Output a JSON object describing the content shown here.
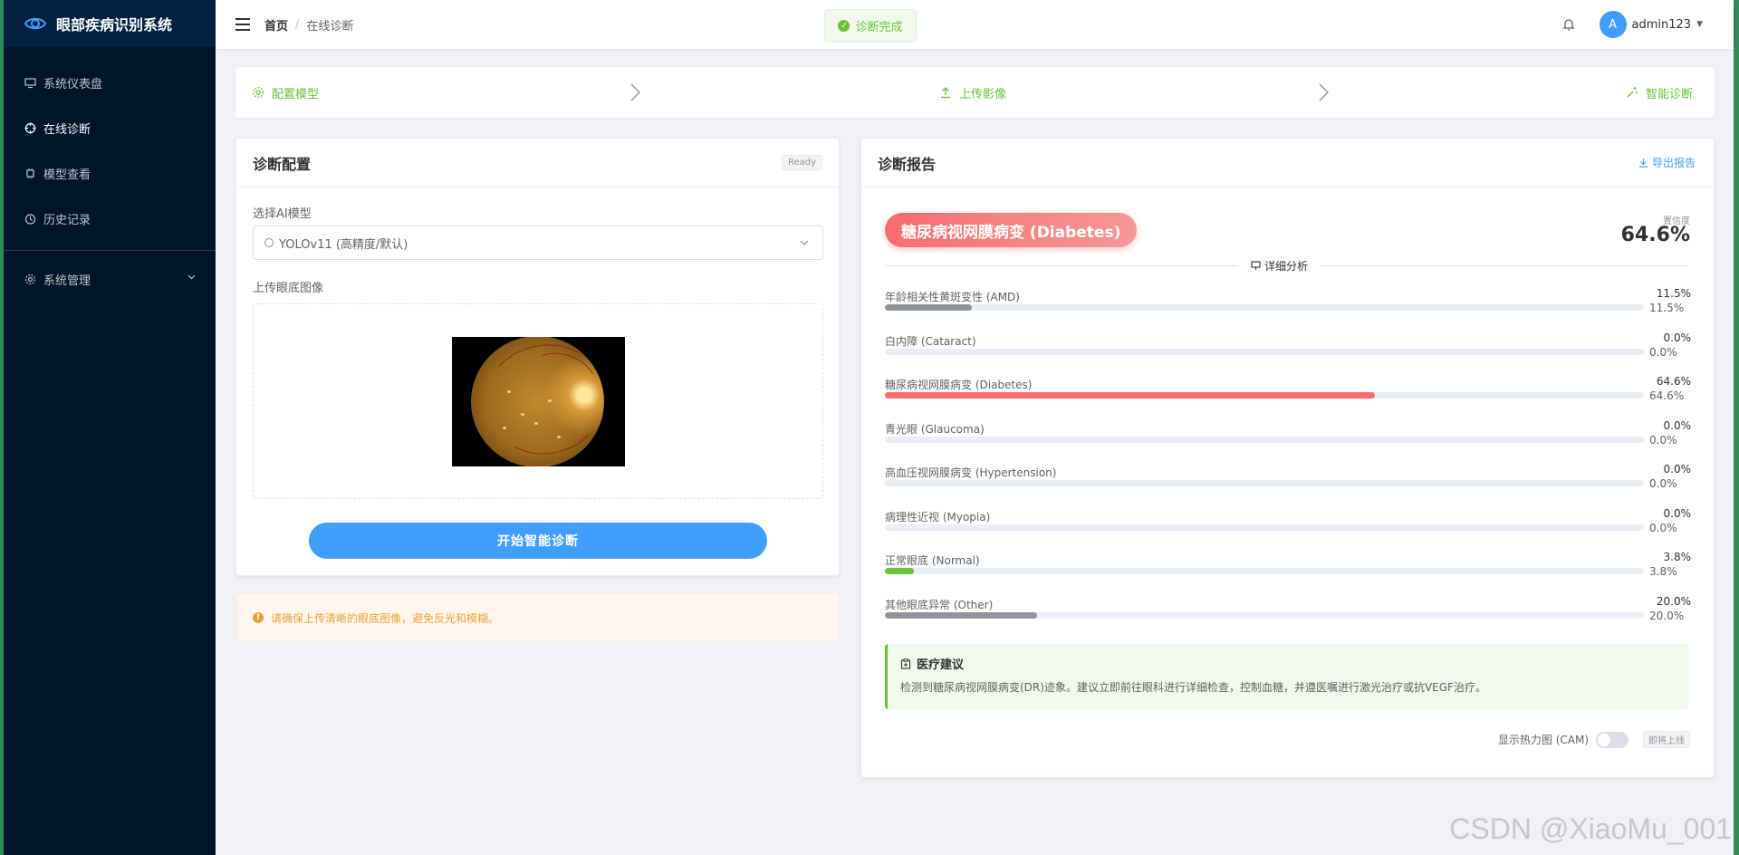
{
  "app": {
    "title": "眼部疾病识别系统"
  },
  "sidebar": {
    "items": [
      {
        "label": "系统仪表盘",
        "icon": "monitor-icon"
      },
      {
        "label": "在线诊断",
        "icon": "target-icon"
      },
      {
        "label": "模型查看",
        "icon": "chip-icon"
      },
      {
        "label": "历史记录",
        "icon": "clock-icon"
      },
      {
        "label": "系统管理",
        "icon": "gear-icon"
      }
    ]
  },
  "header": {
    "breadcrumb": [
      "首页",
      "在线诊断"
    ],
    "breadcrumb_sep": "/",
    "toast": "诊断完成",
    "avatar_letter": "A",
    "username": "admin123"
  },
  "steps": [
    {
      "label": "配置模型"
    },
    {
      "label": "上传影像"
    },
    {
      "label": "智能诊断"
    }
  ],
  "config": {
    "title": "诊断配置",
    "status": "Ready",
    "model_label": "选择AI模型",
    "model_value": "YOLOv11 (高精度/默认)",
    "upload_label": "上传眼底图像",
    "diagnose_button": "开始智能诊断"
  },
  "alert": {
    "text": "请确保上传清晰的眼底图像，避免反光和模糊。"
  },
  "report": {
    "title": "诊断报告",
    "export": "导出报告",
    "result": "糖尿病视网膜病变 (Diabetes)",
    "confidence_label": "置信度",
    "confidence": "64.6%",
    "analysis_label": "详细分析",
    "probabilities": [
      {
        "name": "年龄相关性黄斑变性 (AMD)",
        "pct": "11.5%",
        "value": 11.5,
        "color": "#909399"
      },
      {
        "name": "白内障 (Cataract)",
        "pct": "0.0%",
        "value": 0.0,
        "color": "#909399"
      },
      {
        "name": "糖尿病视网膜病变 (Diabetes)",
        "pct": "64.6%",
        "value": 64.6,
        "color": "#f56c6c"
      },
      {
        "name": "青光眼 (Glaucoma)",
        "pct": "0.0%",
        "value": 0.0,
        "color": "#909399"
      },
      {
        "name": "高血压视网膜病变 (Hypertension)",
        "pct": "0.0%",
        "value": 0.0,
        "color": "#909399"
      },
      {
        "name": "病理性近视 (Myopia)",
        "pct": "0.0%",
        "value": 0.0,
        "color": "#909399"
      },
      {
        "name": "正常眼底 (Normal)",
        "pct": "3.8%",
        "value": 3.8,
        "color": "#67c23a"
      },
      {
        "name": "其他眼底异常 (Other)",
        "pct": "20.0%",
        "value": 20.0,
        "color": "#909399"
      }
    ],
    "advice_title": "医疗建议",
    "advice_text": "检测到糖尿病视网膜病变(DR)迹象。建议立即前往眼科进行详细检查，控制血糖，并遵医嘱进行激光治疗或抗VEGF治疗。",
    "cam_label": "显示热力图 (CAM)",
    "cam_on": false,
    "cam_badge": "即将上线"
  },
  "watermark": "CSDN @XiaoMu_001"
}
